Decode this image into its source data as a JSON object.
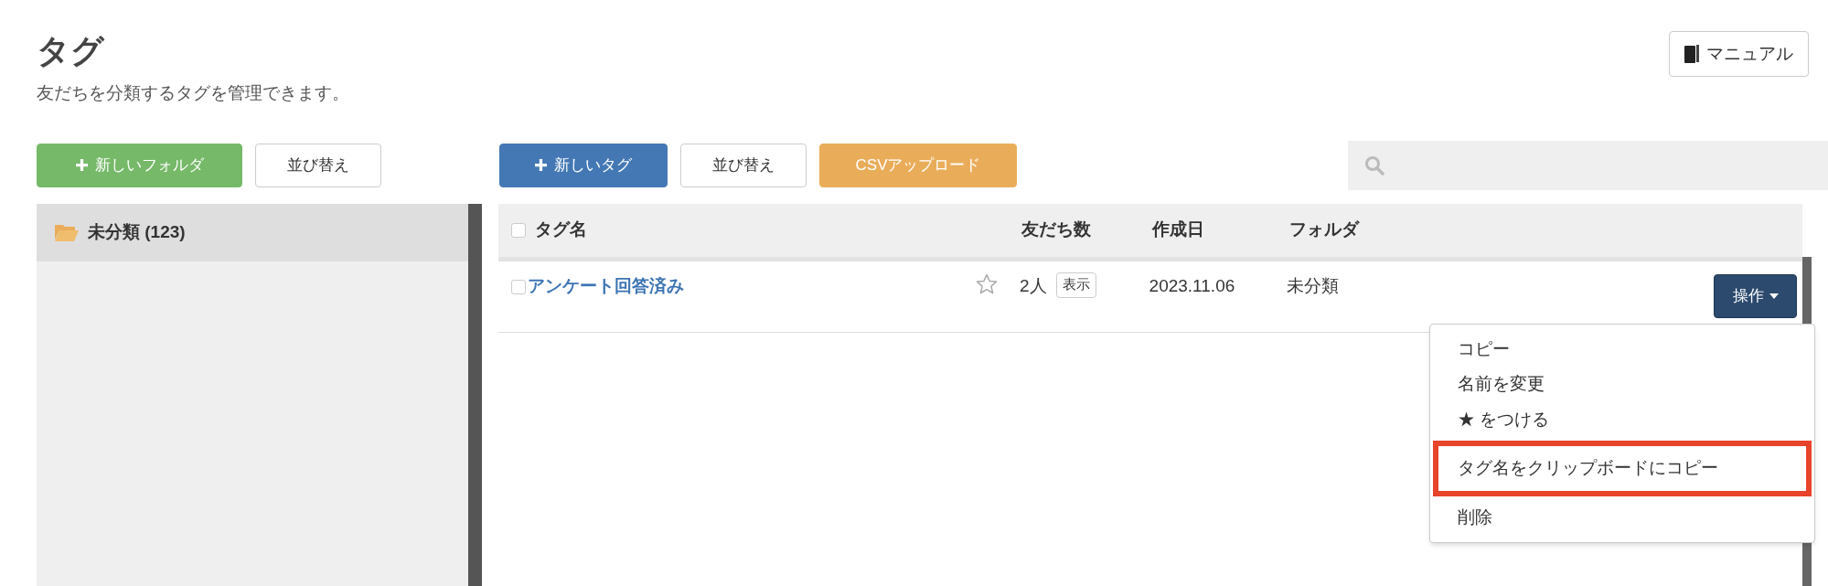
{
  "header": {
    "title": "タグ",
    "subtitle": "友だちを分類するタグを管理できます。",
    "manual_button": "マニュアル"
  },
  "folder_toolbar": {
    "buttons": [
      {
        "kind": "add",
        "label": "新しいフォルダ",
        "color": "#76b969"
      },
      {
        "kind": "plain",
        "label": "並び替え"
      }
    ]
  },
  "tag_toolbar": {
    "buttons": [
      {
        "kind": "add",
        "label": "新しいタグ",
        "color": "#4478b5"
      },
      {
        "kind": "plain",
        "label": "並び替え"
      },
      {
        "kind": "fill",
        "label": "CSVアップロード",
        "color": "#e9ad5a"
      }
    ]
  },
  "folders": [
    {
      "name": "未分類 (123)",
      "selected": true
    }
  ],
  "table": {
    "columns": [
      "タグ名",
      "友だち数",
      "作成日",
      "フォルダ"
    ],
    "all_checked": false,
    "rows": [
      {
        "checked": false,
        "name": "アンケート回答済み",
        "starred": false,
        "count": "2人",
        "view_button": "表示",
        "created": "2023.11.06",
        "folder": "未分類",
        "action_button": "操作"
      }
    ]
  },
  "action_menu": {
    "items": [
      {
        "label": "コピー",
        "highlighted": false
      },
      {
        "label": "名前を変更",
        "highlighted": false
      },
      {
        "label": "★ をつける",
        "highlighted": false
      },
      {
        "label": "タグ名をクリップボードにコピー",
        "highlighted": true
      },
      {
        "label": "削除",
        "highlighted": false
      }
    ]
  }
}
